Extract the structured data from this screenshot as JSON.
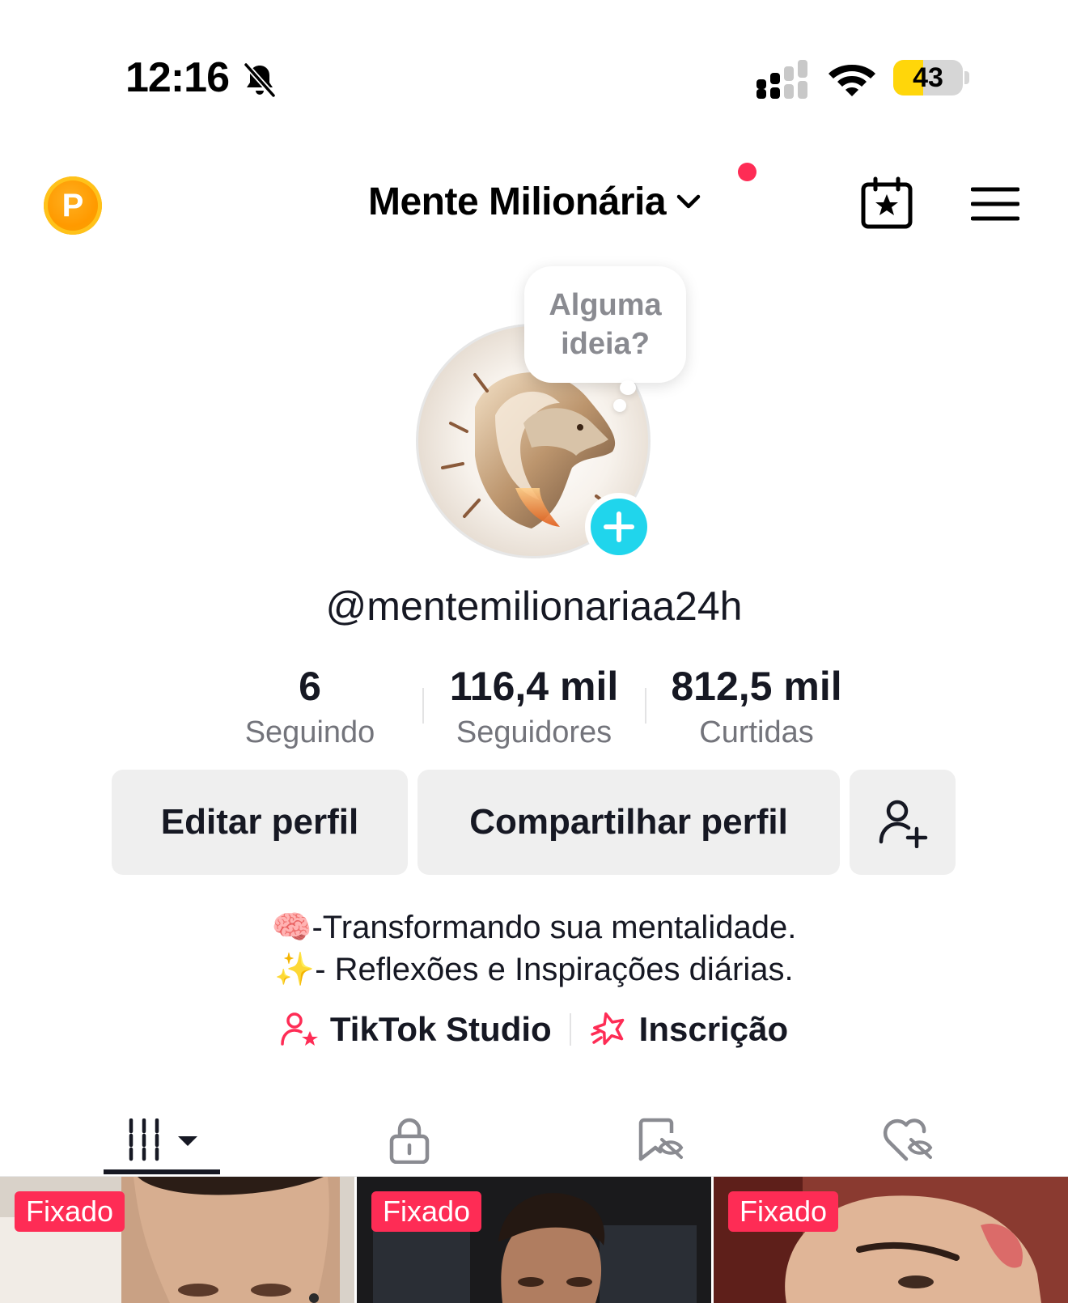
{
  "status_bar": {
    "time": "12:16",
    "battery": "43",
    "battery_level": 0.43,
    "battery_color": "#ffd60a"
  },
  "header": {
    "account_name": "Mente Milionária",
    "coin_letter": "P",
    "icons": [
      "coin-icon",
      "chevron-down-icon",
      "calendar-star-icon",
      "menu-icon"
    ],
    "notification_color": "#fe2c55"
  },
  "avatar": {
    "idea_line1": "Alguma",
    "idea_line2": "ideia?",
    "add_color": "#20d5ec"
  },
  "profile": {
    "username": "@mentemilionariaa24h",
    "stats": {
      "following_value": "6",
      "following_label": "Seguindo",
      "followers_value": "116,4 mil",
      "followers_label": "Seguidores",
      "likes_value": "812,5 mil",
      "likes_label": "Curtidas"
    },
    "buttons": {
      "edit": "Editar perfil",
      "share": "Compartilhar perfil"
    },
    "bio_line1": "🧠-Transformando sua mentalidade.",
    "bio_line2": "✨- Reflexões e Inspirações diárias.",
    "links": {
      "studio": "TikTok Studio",
      "subscription": "Inscrição"
    }
  },
  "tabs": {
    "items": [
      "videos-grid-icon",
      "lock-icon",
      "saved-hidden-icon",
      "liked-hidden-icon"
    ],
    "active": 0
  },
  "videos": [
    {
      "badge": "Fixado"
    },
    {
      "badge": "Fixado"
    },
    {
      "badge": "Fixado"
    }
  ]
}
